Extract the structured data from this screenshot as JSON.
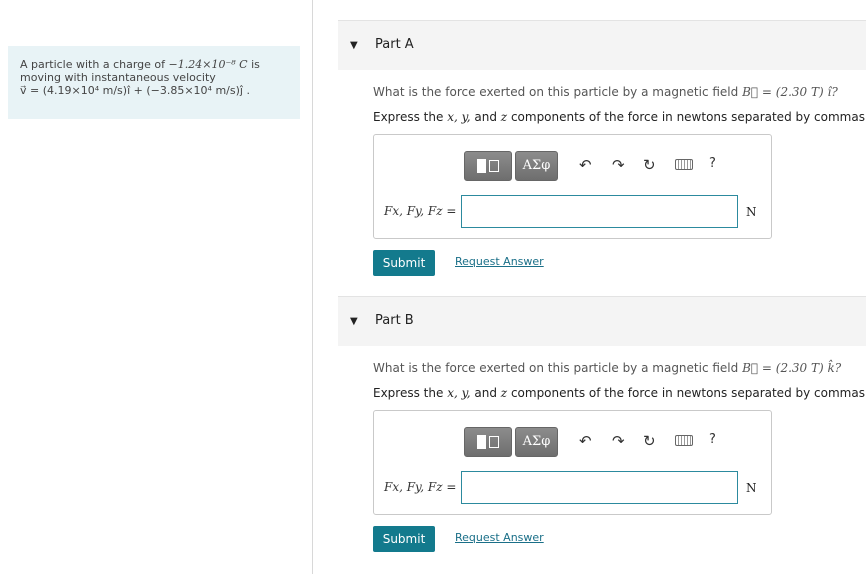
{
  "problem": {
    "line1_pre": "A particle with a charge of ",
    "line1_math": "−1.24×10⁻⁸ C",
    "line1_post": " is",
    "line2": "moving with instantaneous velocity",
    "line3": "v⃗ = (4.19×10⁴ m/s)î + (−3.85×10⁴ m/s)ĵ ."
  },
  "parts": [
    {
      "title": "Part A",
      "question_pre": "What is the force exerted on this particle by a magnetic field ",
      "question_math": "B⃗ = (2.30 T) î?",
      "instruction_pre": "Express the ",
      "instruction_math": "x, y, ",
      "instruction_and": "and ",
      "instruction_math2": "z",
      "instruction_post": " components of the force in newtons separated by commas.",
      "variables": "Fx, Fy, Fz =",
      "unit": "N",
      "input_value": "",
      "submit_label": "Submit",
      "request_label": "Request Answer",
      "template_icon": "template-icon",
      "symbols_label": "ΑΣφ"
    },
    {
      "title": "Part B",
      "question_pre": "What is the force exerted on this particle by a magnetic field ",
      "question_math": "B⃗ = (2.30 T) k̂?",
      "instruction_pre": "Express the ",
      "instruction_math": "x, y, ",
      "instruction_and": "and ",
      "instruction_math2": "z",
      "instruction_post": " components of the force in newtons separated by commas.",
      "variables": "Fx, Fy, Fz =",
      "unit": "N",
      "input_value": "",
      "submit_label": "Submit",
      "request_label": "Request Answer",
      "template_icon": "template-icon",
      "symbols_label": "ΑΣφ"
    }
  ],
  "toolbar": {
    "undo_icon": "undo-icon",
    "redo_icon": "redo-icon",
    "reset_icon": "reset-icon",
    "keyboard_icon": "keyboard-icon",
    "help_label": "?"
  }
}
